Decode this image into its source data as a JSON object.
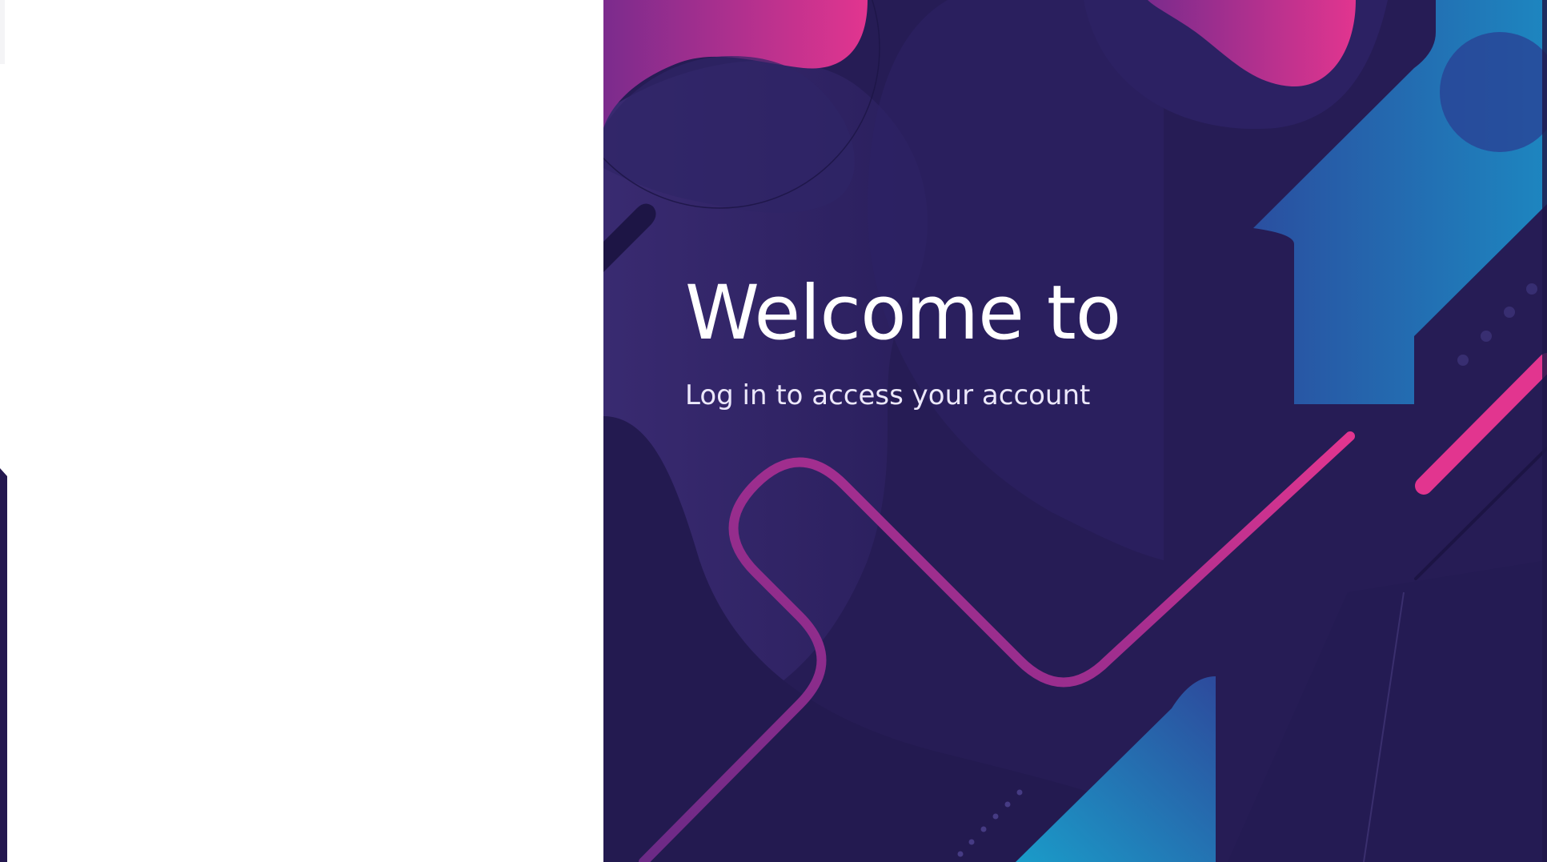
{
  "welcome_panel": {
    "title": "Welcome to",
    "subtitle": "Log in to access your account"
  },
  "colors": {
    "left_panel_background": "#ffffff",
    "right_panel_background": "#271d57",
    "accent_pink": "#e2358f",
    "accent_purple": "#8b2d8f",
    "accent_blue": "#1f8fc2",
    "text_white": "#ffffff"
  }
}
